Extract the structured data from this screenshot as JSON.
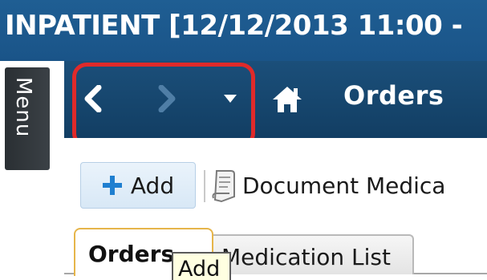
{
  "header": {
    "top_fragment": "",
    "title": "INPATIENT [12/12/2013 11:00 -"
  },
  "menu": {
    "label": "Menu"
  },
  "navigation": {
    "back_icon": "chevron-left-icon",
    "forward_icon": "chevron-right-icon",
    "dropdown_icon": "caret-down-icon",
    "home_icon": "home-icon",
    "page_title": "Orders"
  },
  "toolbar": {
    "add_label": "Add",
    "document_medication_label": "Document Medica"
  },
  "tabs": [
    {
      "label": "Orders",
      "active": true
    },
    {
      "label": "Medication List",
      "active": false
    }
  ],
  "tooltip": {
    "text": "Add"
  },
  "colors": {
    "header_blue": "#1f5e93",
    "nav_blue": "#1b4f7a",
    "highlight_red": "#e02a2a",
    "active_tab_border": "#e6b54a",
    "add_icon_blue": "#1f7fd0"
  }
}
